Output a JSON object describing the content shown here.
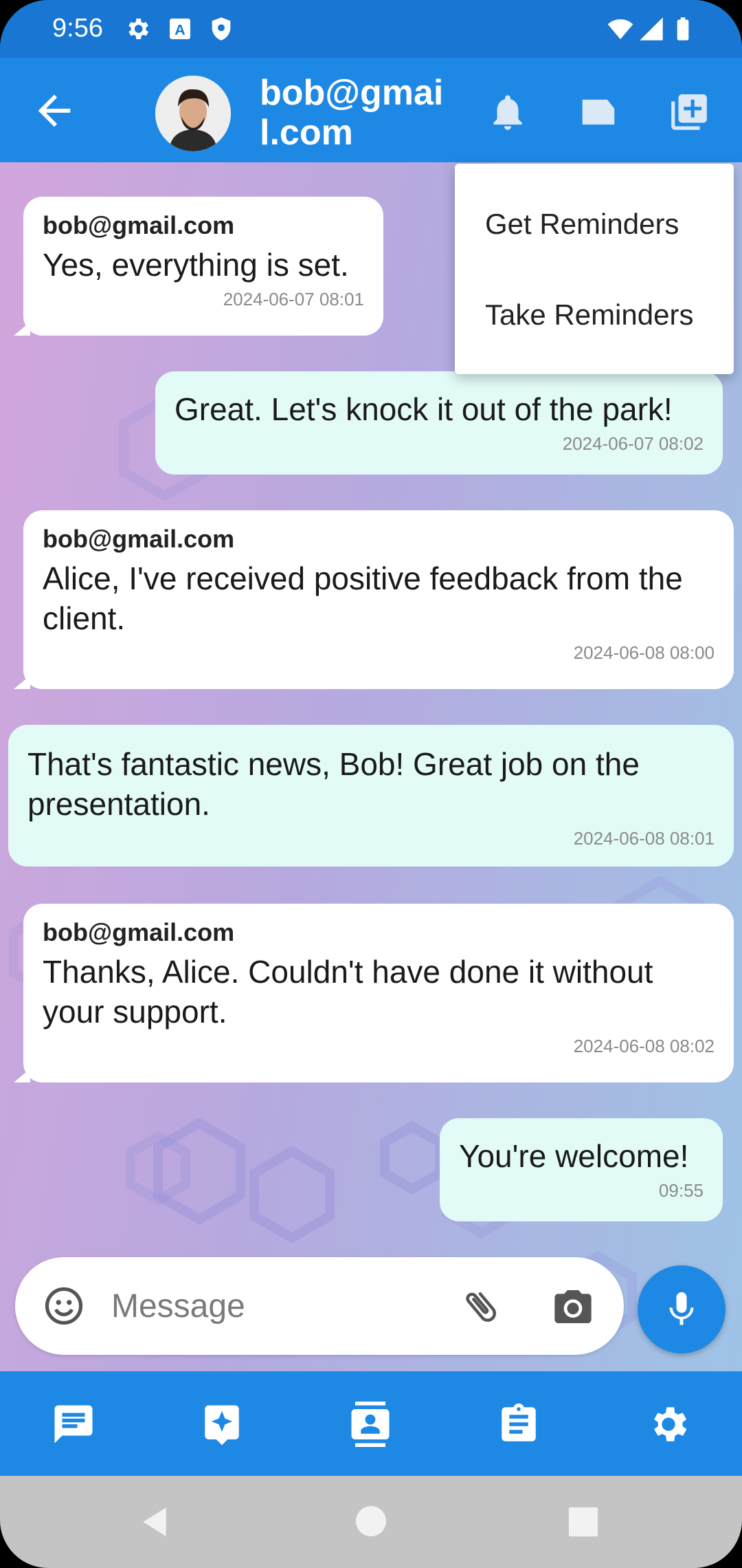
{
  "status_bar": {
    "time": "9:56",
    "icons": [
      "gear-icon",
      "a-icon",
      "shield-icon",
      "wifi-icon",
      "signal-icon",
      "battery-icon"
    ]
  },
  "app_bar": {
    "title": "bob@gmail.com",
    "icons": [
      "back-arrow-icon",
      "bell-icon",
      "label-icon",
      "add-box-icon"
    ]
  },
  "menu": {
    "items": [
      {
        "label": "Get Reminders"
      },
      {
        "label": "Take Reminders"
      }
    ]
  },
  "messages": [
    {
      "direction": "incoming",
      "sender": "bob@gmail.com",
      "text": "Yes, everything is set.",
      "time": "2024-06-07 08:01"
    },
    {
      "direction": "outgoing",
      "text": "Great. Let's knock it out of the park!",
      "time": "2024-06-07 08:02"
    },
    {
      "direction": "incoming",
      "sender": "bob@gmail.com",
      "text": "Alice, I've received positive feedback from the client.",
      "time": "2024-06-08 08:00"
    },
    {
      "direction": "outgoing",
      "text": "That's fantastic news, Bob! Great job on the presentation.",
      "time": "2024-06-08 08:01"
    },
    {
      "direction": "incoming",
      "sender": "bob@gmail.com",
      "text": "Thanks, Alice. Couldn't have done it without your support.",
      "time": "2024-06-08 08:02"
    },
    {
      "direction": "outgoing",
      "text": "You're welcome!",
      "time": "09:55"
    }
  ],
  "composer": {
    "placeholder": "Message",
    "icons": [
      "emoji-icon",
      "attach-icon",
      "camera-icon",
      "mic-icon"
    ]
  },
  "bottom_nav": {
    "items": [
      "chat-icon",
      "ai-chat-icon",
      "contacts-icon",
      "clipboard-icon",
      "settings-icon"
    ]
  },
  "colors": {
    "primary": "#1E88E5",
    "status_bar": "#1976D2",
    "incoming_bubble": "#FFFFFF",
    "outgoing_bubble": "#E3FBF7"
  }
}
